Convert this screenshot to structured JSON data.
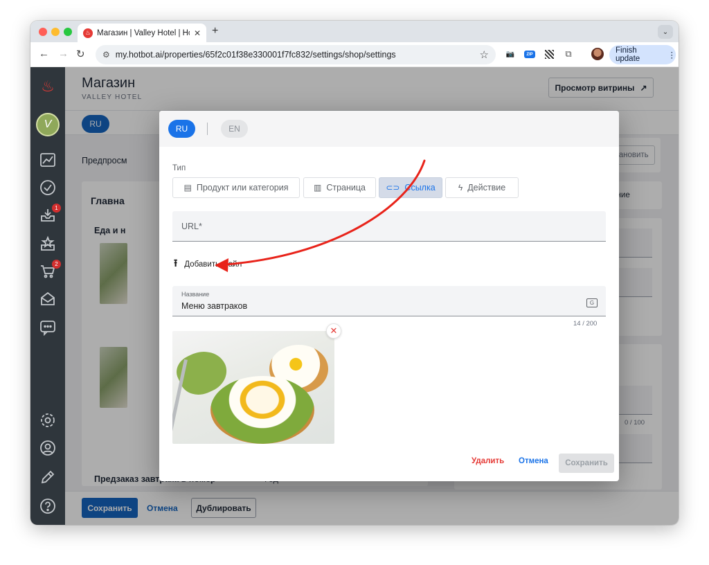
{
  "browser": {
    "tab_title": "Магазин | Valley Hotel | Hotbot",
    "url": "my.hotbot.ai/properties/65f2c01f38e330001f7fc832/settings/shop/settings",
    "finish_update": "Finish update",
    "zip_label": "ZIP"
  },
  "sidebar": {
    "avatar_letter": "V",
    "badges": {
      "inbox": "1",
      "cart": "2"
    }
  },
  "page": {
    "title": "Магазин",
    "subtitle": "VALLEY HOTEL",
    "storefront_button": "Просмотр витрины",
    "lang_active": "RU",
    "background": {
      "preview_label": "Предпросм",
      "pause_button": "Приостановить",
      "main_section": "Главна",
      "food_section": "Еда и н",
      "limit_label": "ограничение",
      "counter": "0 / 100",
      "bottom_item": "Предзаказ завтрака в номер",
      "bottom_item_suffix": "Год"
    },
    "footer": {
      "save": "Сохранить",
      "cancel": "Отмена",
      "duplicate": "Дублировать"
    }
  },
  "modal": {
    "lang_ru": "RU",
    "lang_en": "EN",
    "type_label": "Тип",
    "types": [
      {
        "label": "Продукт или категория",
        "icon": "store-icon",
        "active": false
      },
      {
        "label": "Страница",
        "icon": "page-icon",
        "active": false
      },
      {
        "label": "Ссылка",
        "icon": "link-icon",
        "active": true
      },
      {
        "label": "Действие",
        "icon": "bolt-icon",
        "active": false
      }
    ],
    "url_placeholder": "URL*",
    "add_file": "Добавить файл",
    "name_label": "Название",
    "name_value": "Меню завтраков",
    "name_counter": "14 / 200",
    "delete": "Удалить",
    "cancel": "Отмена",
    "save": "Сохранить"
  },
  "colors": {
    "primary": "#1a73e8",
    "danger": "#e53935",
    "sidebar": "#2f363c",
    "annotation_arrow": "#e8231a"
  }
}
